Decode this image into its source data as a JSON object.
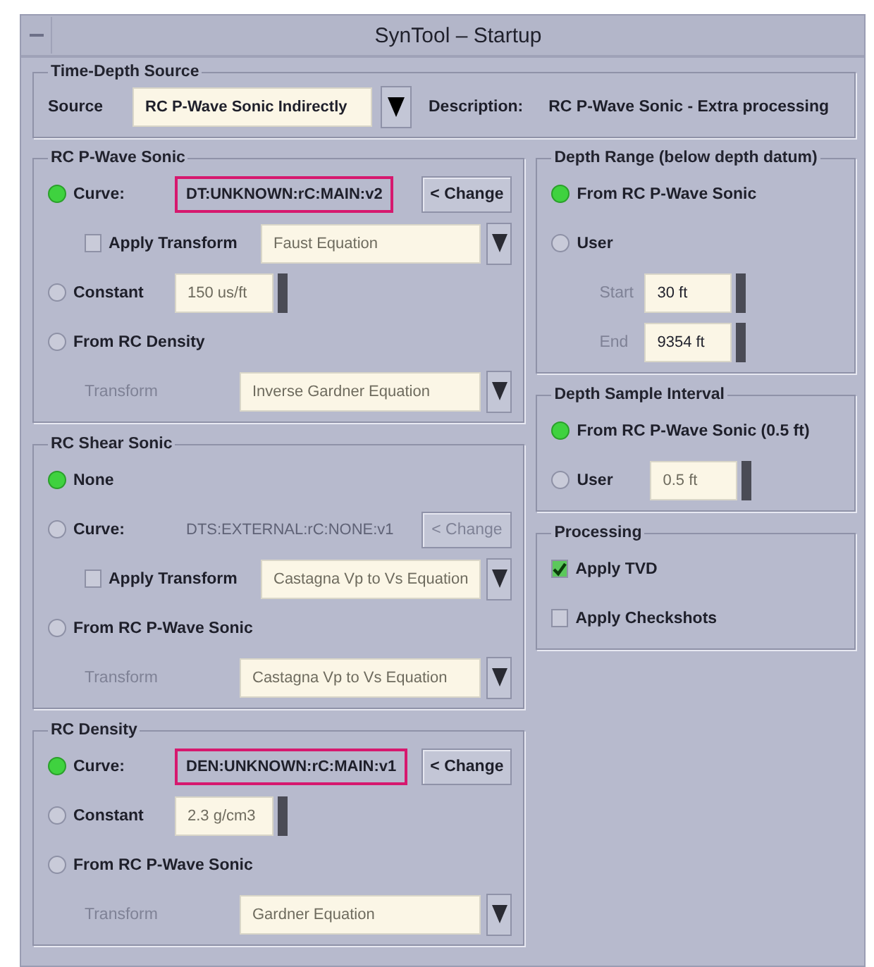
{
  "window": {
    "title": "SynTool – Startup"
  },
  "time_depth_source": {
    "title": "Time-Depth Source",
    "source_label": "Source",
    "source_value": "RC P-Wave Sonic Indirectly",
    "description_label": "Description:",
    "description_value": "RC P-Wave Sonic - Extra processing"
  },
  "left_groups": [
    {
      "title": "RC P-Wave Sonic",
      "rows": [
        {
          "kind": "radio",
          "label": "Curve:",
          "selected": true,
          "field": {
            "kind": "curve",
            "value": "DT:UNKNOWN:rC:MAIN:v2",
            "highlighted": true,
            "disabled": false
          },
          "button": {
            "label": "< Change",
            "disabled": false
          }
        },
        {
          "kind": "sub-check",
          "label": "Apply Transform",
          "checked": false,
          "field": {
            "kind": "combo",
            "value": "Faust Equation",
            "disabled": true
          }
        },
        {
          "kind": "radio",
          "label": "Constant",
          "selected": false,
          "field": {
            "kind": "spin",
            "value": "150 us/ft",
            "disabled": true
          }
        },
        {
          "kind": "radio",
          "label": "From RC Density",
          "selected": false
        },
        {
          "kind": "label",
          "label": "Transform",
          "disabled": true,
          "field": {
            "kind": "combo",
            "value": "Inverse Gardner Equation",
            "disabled": true
          }
        }
      ]
    },
    {
      "title": "RC Shear Sonic",
      "rows": [
        {
          "kind": "radio",
          "label": "None",
          "selected": true
        },
        {
          "kind": "radio",
          "label": "Curve:",
          "selected": false,
          "field": {
            "kind": "curve",
            "value": "DTS:EXTERNAL:rC:NONE:v1",
            "highlighted": false,
            "disabled": true
          },
          "button": {
            "label": "< Change",
            "disabled": true
          }
        },
        {
          "kind": "sub-check",
          "label": "Apply Transform",
          "checked": false,
          "field": {
            "kind": "combo",
            "value": "Castagna Vp to Vs Equation",
            "disabled": true
          }
        },
        {
          "kind": "radio",
          "label": "From RC P-Wave Sonic",
          "selected": false
        },
        {
          "kind": "label",
          "label": "Transform",
          "disabled": true,
          "field": {
            "kind": "combo",
            "value": "Castagna Vp to Vs Equation",
            "disabled": true
          }
        }
      ]
    },
    {
      "title": "RC Density",
      "rows": [
        {
          "kind": "radio",
          "label": "Curve:",
          "selected": true,
          "field": {
            "kind": "curve",
            "value": "DEN:UNKNOWN:rC:MAIN:v1",
            "highlighted": true,
            "disabled": false
          },
          "button": {
            "label": "< Change",
            "disabled": false
          }
        },
        {
          "kind": "radio",
          "label": "Constant",
          "selected": false,
          "field": {
            "kind": "spin",
            "value": "2.3 g/cm3",
            "disabled": true
          }
        },
        {
          "kind": "radio",
          "label": "From RC P-Wave Sonic",
          "selected": false
        },
        {
          "kind": "label",
          "label": "Transform",
          "disabled": true,
          "field": {
            "kind": "combo",
            "value": "Gardner Equation",
            "disabled": true
          }
        }
      ]
    }
  ],
  "right_groups": [
    {
      "title": "Depth Range (below depth datum)",
      "rows": [
        {
          "kind": "radio",
          "label": "From RC P-Wave Sonic",
          "selected": true
        },
        {
          "kind": "radio",
          "label": "User",
          "selected": false
        },
        {
          "kind": "label",
          "label": "Start",
          "disabled": true,
          "field": {
            "kind": "spin",
            "value": "30 ft",
            "disabled": false
          }
        },
        {
          "kind": "label",
          "label": "End",
          "disabled": true,
          "field": {
            "kind": "spin",
            "value": "9354 ft",
            "disabled": false
          }
        }
      ]
    },
    {
      "title": "Depth Sample Interval",
      "rows": [
        {
          "kind": "radio",
          "label": "From RC P-Wave Sonic (0.5 ft)",
          "selected": true
        },
        {
          "kind": "radio",
          "label": "User",
          "selected": false,
          "field": {
            "kind": "spin",
            "value": "0.5 ft",
            "disabled": true
          }
        }
      ]
    },
    {
      "title": "Processing",
      "rows": [
        {
          "kind": "check",
          "label": "Apply TVD",
          "checked": true
        },
        {
          "kind": "check",
          "label": "Apply Checkshots",
          "checked": false
        }
      ]
    }
  ]
}
